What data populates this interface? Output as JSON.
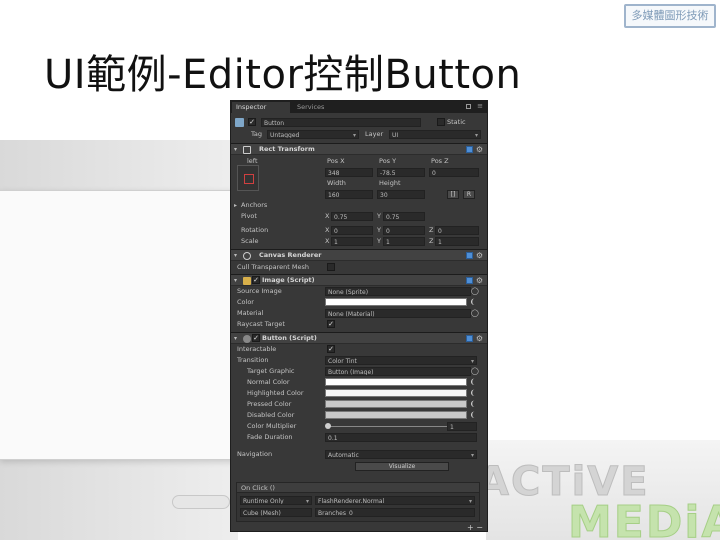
{
  "slide": {
    "title": "UI範例-Editor控制Button",
    "stamp": "多媒體圖形技術",
    "logo_line1": "ACTiVE",
    "logo_line2": "MEDiA"
  },
  "colors": {
    "panel_bg": "#383838",
    "header_bg": "#424242",
    "field_bg": "#2a2a2a",
    "accent_blue": "#4f8fd6",
    "logo_gray": "#cfcfcf",
    "logo_green": "#b9dc9a"
  },
  "inspector": {
    "tabs": [
      "Inspector",
      "Services"
    ],
    "object_name": "Button",
    "static_label": "Static",
    "tag_label": "Tag",
    "tag_value": "Untagged",
    "layer_label": "Layer",
    "layer_value": "UI",
    "rect_transform": {
      "title": "Rect Transform",
      "left_label": "left",
      "pos_x_label": "Pos X",
      "pos_y_label": "Pos Y",
      "pos_z_label": "Pos Z",
      "pos_x": "348",
      "pos_y": "-78.5",
      "pos_z": "0",
      "width_label": "Width",
      "height_label": "Height",
      "width": "160",
      "height": "30",
      "r_button": "R",
      "anchors_label": "Anchors",
      "pivot_label": "Pivot",
      "pivot_x": "0.75",
      "pivot_y": "0.75",
      "rotation_label": "Rotation",
      "rot_x": "0",
      "rot_y": "0",
      "rot_z": "0",
      "scale_label": "Scale",
      "scale_x": "1",
      "scale_y": "1",
      "scale_z": "1",
      "x": "X",
      "y": "Y",
      "z": "Z"
    },
    "canvas_renderer": {
      "title": "Canvas Renderer",
      "cull_label": "Cull Transparent Mesh"
    },
    "image": {
      "title": "Image (Script)",
      "source_label": "Source Image",
      "source_value": "None (Sprite)",
      "color_label": "Color",
      "material_label": "Material",
      "material_value": "None (Material)",
      "raycast_label": "Raycast Target"
    },
    "button": {
      "title": "Button (Script)",
      "interactable_label": "Interactable",
      "transition_label": "Transition",
      "transition_value": "Color Tint",
      "target_label": "Target Graphic",
      "target_value": "Button (Image)",
      "normal_label": "Normal Color",
      "highlighted_label": "Highlighted Color",
      "pressed_label": "Pressed Color",
      "disabled_label": "Disabled Color",
      "multiplier_label": "Color Multiplier",
      "multiplier_value": "1",
      "fade_label": "Fade Duration",
      "fade_value": "0.1",
      "navigation_label": "Navigation",
      "navigation_value": "Automatic",
      "visualize_label": "Visualize"
    },
    "on_click": {
      "header": "On Click ()",
      "runtime": "Runtime Only",
      "function": "FlashRenderer.Normal",
      "target": "Cube (Mesh)",
      "param": "Branches_0"
    }
  }
}
